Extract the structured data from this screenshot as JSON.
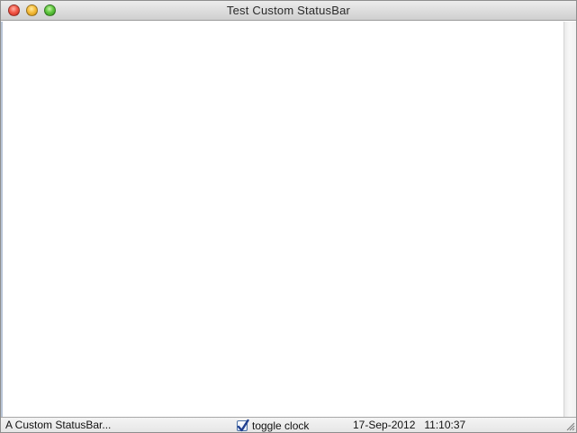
{
  "window": {
    "title": "Test Custom StatusBar"
  },
  "statusbar": {
    "message": "A Custom StatusBar...",
    "toggle_label": "toggle clock",
    "toggle_checked": true,
    "clock": "17-Sep-2012   11:10:37"
  },
  "icons": {
    "close": "close-button-icon",
    "minimize": "minimize-button-icon",
    "zoom": "zoom-button-icon",
    "check": "checkmark-icon",
    "grip": "resize-grip-icon"
  },
  "colors": {
    "close": "#f25a4a",
    "minimize": "#f5bd3b",
    "zoom": "#5fc73f",
    "checkbox_check": "#1f3f8f"
  }
}
